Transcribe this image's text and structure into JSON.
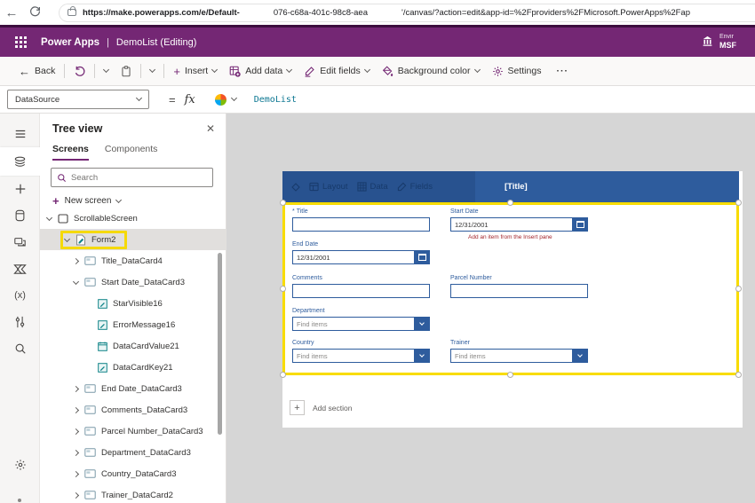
{
  "browser": {
    "url_prefix": "https://make.powerapps.com/e/Default-",
    "url_mid": "076-c68a-401c-98c8-aeа",
    "url_suffix": "'/canvas/?action=edit&app-id=%2Fproviders%2FMicrosoft.PowerApps%2Fap"
  },
  "app_header": {
    "brand": "Power Apps",
    "divider": "|",
    "title": "DemoList (Editing)",
    "environment_label": "Envir",
    "environment_value": "MSF"
  },
  "command_bar": {
    "back": "Back",
    "insert": "Insert",
    "add_data": "Add data",
    "edit_fields": "Edit fields",
    "background_color": "Background color",
    "settings": "Settings",
    "more": "···"
  },
  "formula_bar": {
    "property": "DataSource",
    "equals": "=",
    "fx": "fx",
    "formula": "DemoList"
  },
  "tree_panel": {
    "title": "Tree view",
    "tabs": [
      "Screens",
      "Components"
    ],
    "active_tab": "Screens",
    "search_placeholder": "Search",
    "new_screen_label": "New screen",
    "items": [
      {
        "label": "ScrollableScreen",
        "icon": "screen",
        "chevron": "expanded",
        "level": 0
      },
      {
        "label": "Form2",
        "icon": "form",
        "chevron": "expanded",
        "level": 1,
        "selected": true,
        "highlighted": true
      },
      {
        "label": "Title_DataCard4",
        "icon": "datacard",
        "chevron": "collapsed",
        "level": 2
      },
      {
        "label": "Start Date_DataCard3",
        "icon": "datacard",
        "chevron": "expanded",
        "level": 2
      },
      {
        "label": "StarVisible16",
        "icon": "label",
        "chevron": "none",
        "level": 3
      },
      {
        "label": "ErrorMessage16",
        "icon": "label",
        "chevron": "none",
        "level": 3
      },
      {
        "label": "DataCardValue21",
        "icon": "datepicker",
        "chevron": "none",
        "level": 3
      },
      {
        "label": "DataCardKey21",
        "icon": "label",
        "chevron": "none",
        "level": 3
      },
      {
        "label": "End Date_DataCard3",
        "icon": "datacard",
        "chevron": "collapsed",
        "level": 2
      },
      {
        "label": "Comments_DataCard3",
        "icon": "datacard",
        "chevron": "collapsed",
        "level": 2
      },
      {
        "label": "Parcel Number_DataCard3",
        "icon": "datacard",
        "chevron": "collapsed",
        "level": 2
      },
      {
        "label": "Department_DataCard3",
        "icon": "datacard",
        "chevron": "collapsed",
        "level": 2
      },
      {
        "label": "Country_DataCard3",
        "icon": "datacard",
        "chevron": "collapsed",
        "level": 2
      },
      {
        "label": "Trainer_DataCard2",
        "icon": "datacard",
        "chevron": "collapsed",
        "level": 2
      }
    ]
  },
  "canvas": {
    "form_toolbar": {
      "layout": "Layout",
      "data": "Data",
      "fields": "Fields"
    },
    "form_title": "[Title]",
    "required_marker": "*",
    "add_section_label": "Add section",
    "fields": [
      {
        "label": "Title",
        "required": true,
        "control": "text",
        "value": "",
        "column": 1,
        "row": 1
      },
      {
        "label": "Start Date",
        "required": false,
        "control": "date",
        "value": "12/31/2001",
        "column": 2,
        "row": 1,
        "hint": "Add an item from the Insert pane"
      },
      {
        "label": "End Date",
        "required": false,
        "control": "date",
        "value": "12/31/2001",
        "column": 1,
        "row": 2
      },
      {
        "label": "Comments",
        "required": false,
        "control": "text",
        "value": "",
        "column": 1,
        "row": 3
      },
      {
        "label": "Parcel Number",
        "required": false,
        "control": "text",
        "value": "",
        "column": 2,
        "row": 3
      },
      {
        "label": "Department",
        "required": false,
        "control": "combo",
        "value": "Find items",
        "column": 1,
        "row": 4
      },
      {
        "label": "Country",
        "required": false,
        "control": "combo",
        "value": "Find items",
        "column": 1,
        "row": 5
      },
      {
        "label": "Trainer",
        "required": false,
        "control": "combo",
        "value": "Find items",
        "column": 2,
        "row": 5
      }
    ]
  },
  "colors": {
    "brand_purple": "#742774",
    "form_blue": "#2e5c9d",
    "selection_yellow": "#f8dc00",
    "error_red": "#a4262c"
  }
}
